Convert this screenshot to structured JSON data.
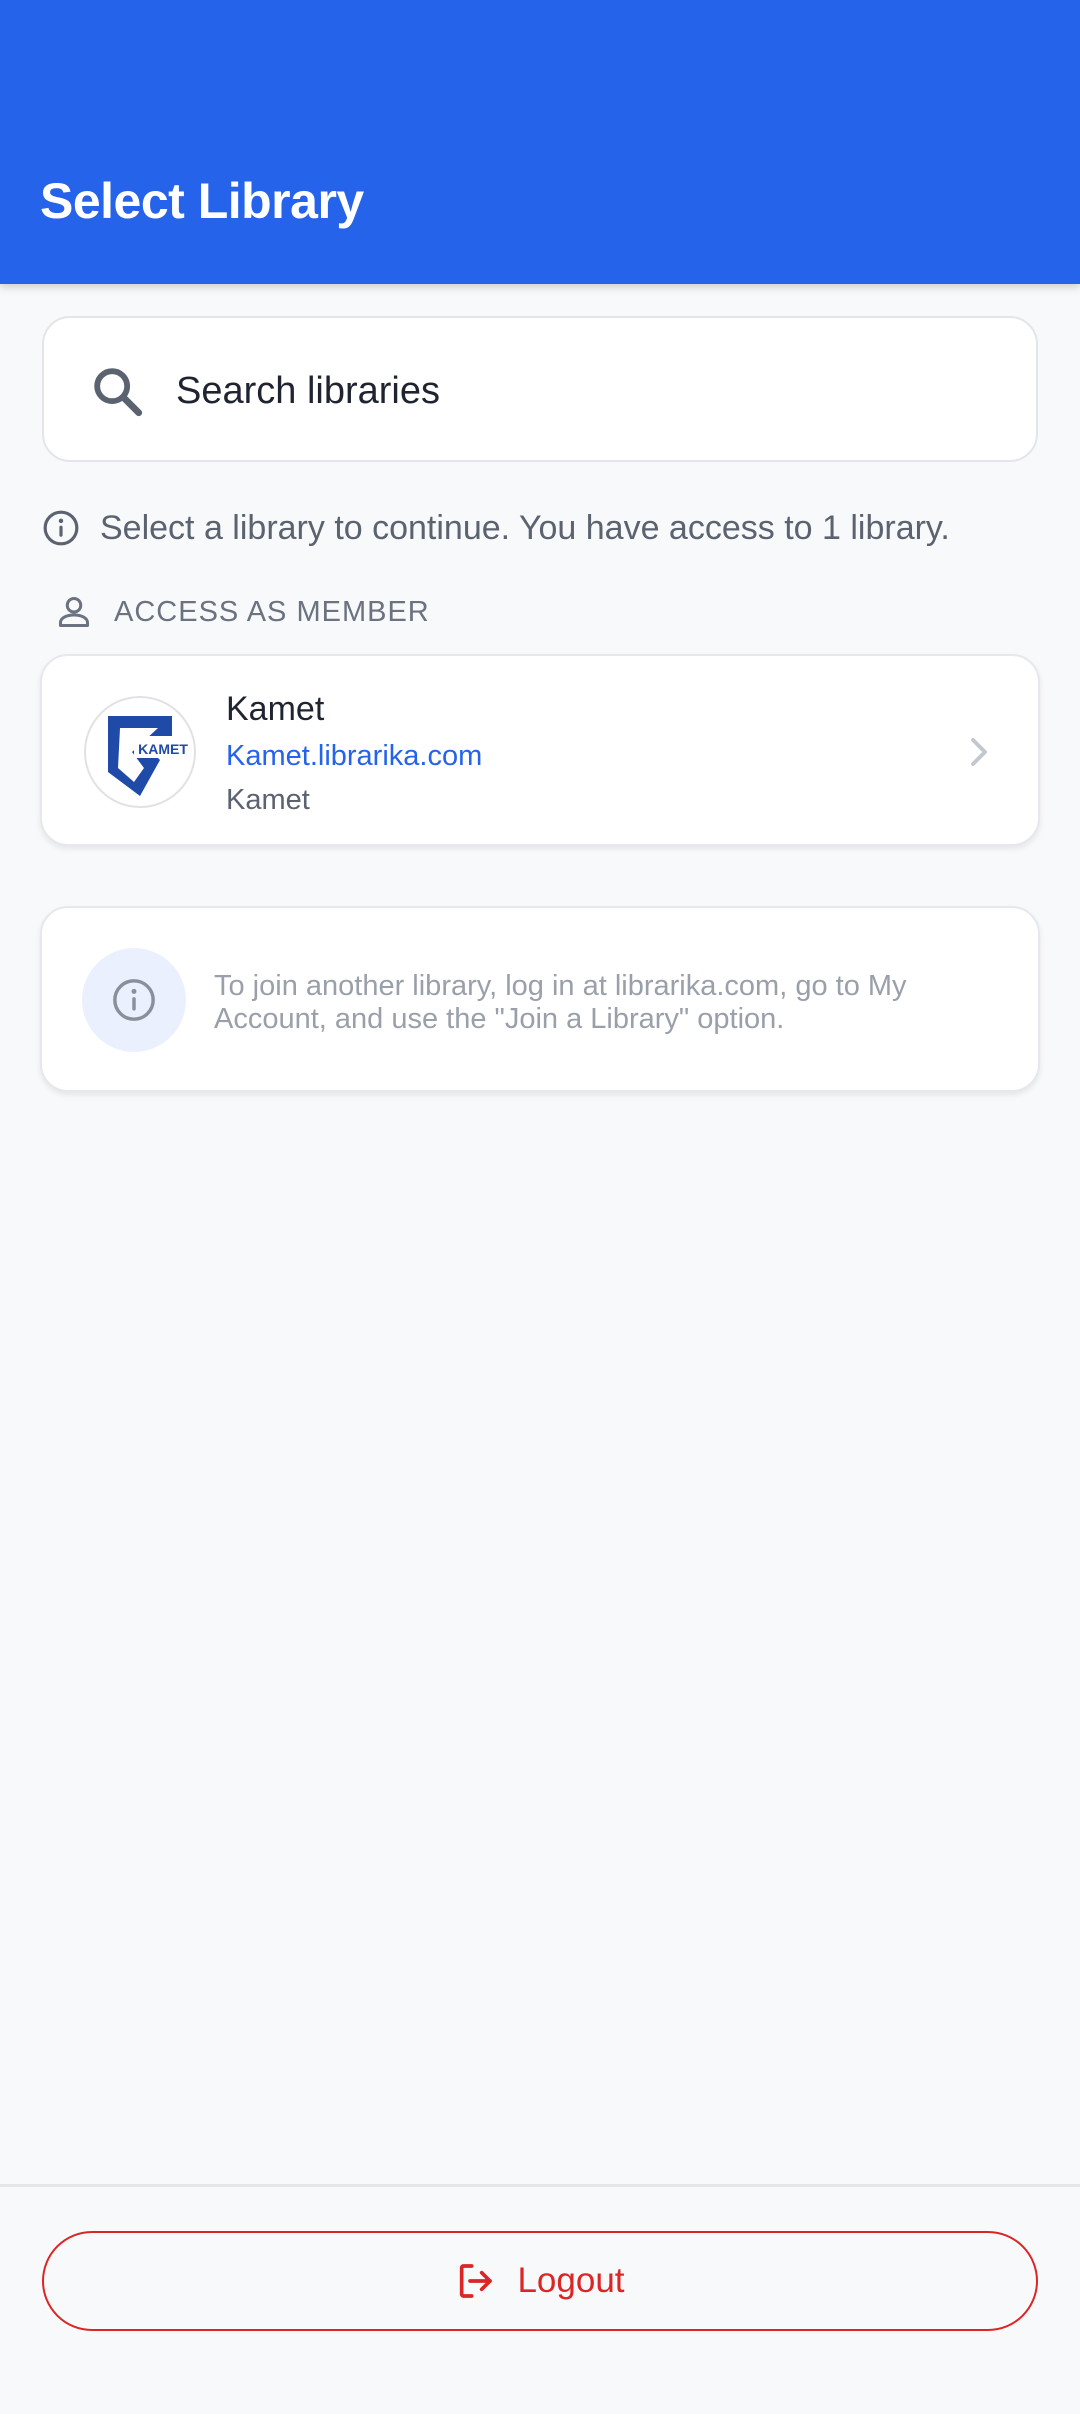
{
  "header": {
    "title": "Select Library"
  },
  "search": {
    "placeholder": "Search libraries",
    "value": ""
  },
  "hint": {
    "text": "Select a library to continue. You have access to 1 library."
  },
  "section": {
    "label": "ACCESS AS MEMBER"
  },
  "libraries": [
    {
      "name": "Kamet",
      "url": "Kamet.librarika.com",
      "subtitle": "Kamet",
      "logo_text": "KAMET"
    }
  ],
  "notice": {
    "text": "To join another library, log in at librarika.com, go to My Account, and use the \"Join a Library\" option."
  },
  "footer": {
    "logout_label": "Logout"
  },
  "colors": {
    "primary": "#2563eb",
    "danger": "#dc2626",
    "background": "#f8f9fb"
  },
  "icons": [
    "search-icon",
    "info-icon",
    "person-icon",
    "chevron-right-icon",
    "logout-icon"
  ]
}
